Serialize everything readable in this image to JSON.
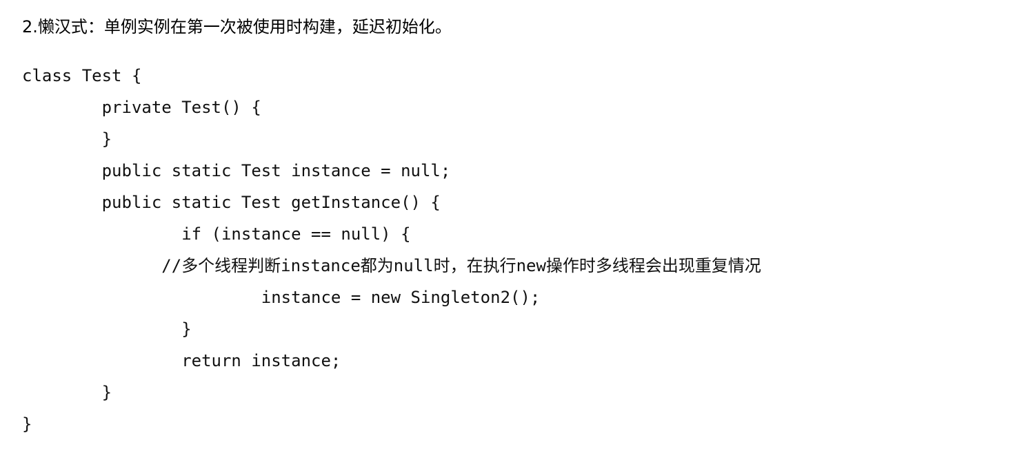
{
  "heading": "2.懒汉式：单例实例在第一次被使用时构建，延迟初始化。",
  "code_lines": [
    "class Test {",
    "        private Test() {",
    "        }",
    "        public static Test instance = null;",
    "        public static Test getInstance() {",
    "                if (instance == null) {",
    "              //多个线程判断instance都为null时，在执行new操作时多线程会出现重复情况",
    "                        instance = new Singleton2();",
    "                }",
    "                return instance;",
    "        }",
    "}"
  ]
}
